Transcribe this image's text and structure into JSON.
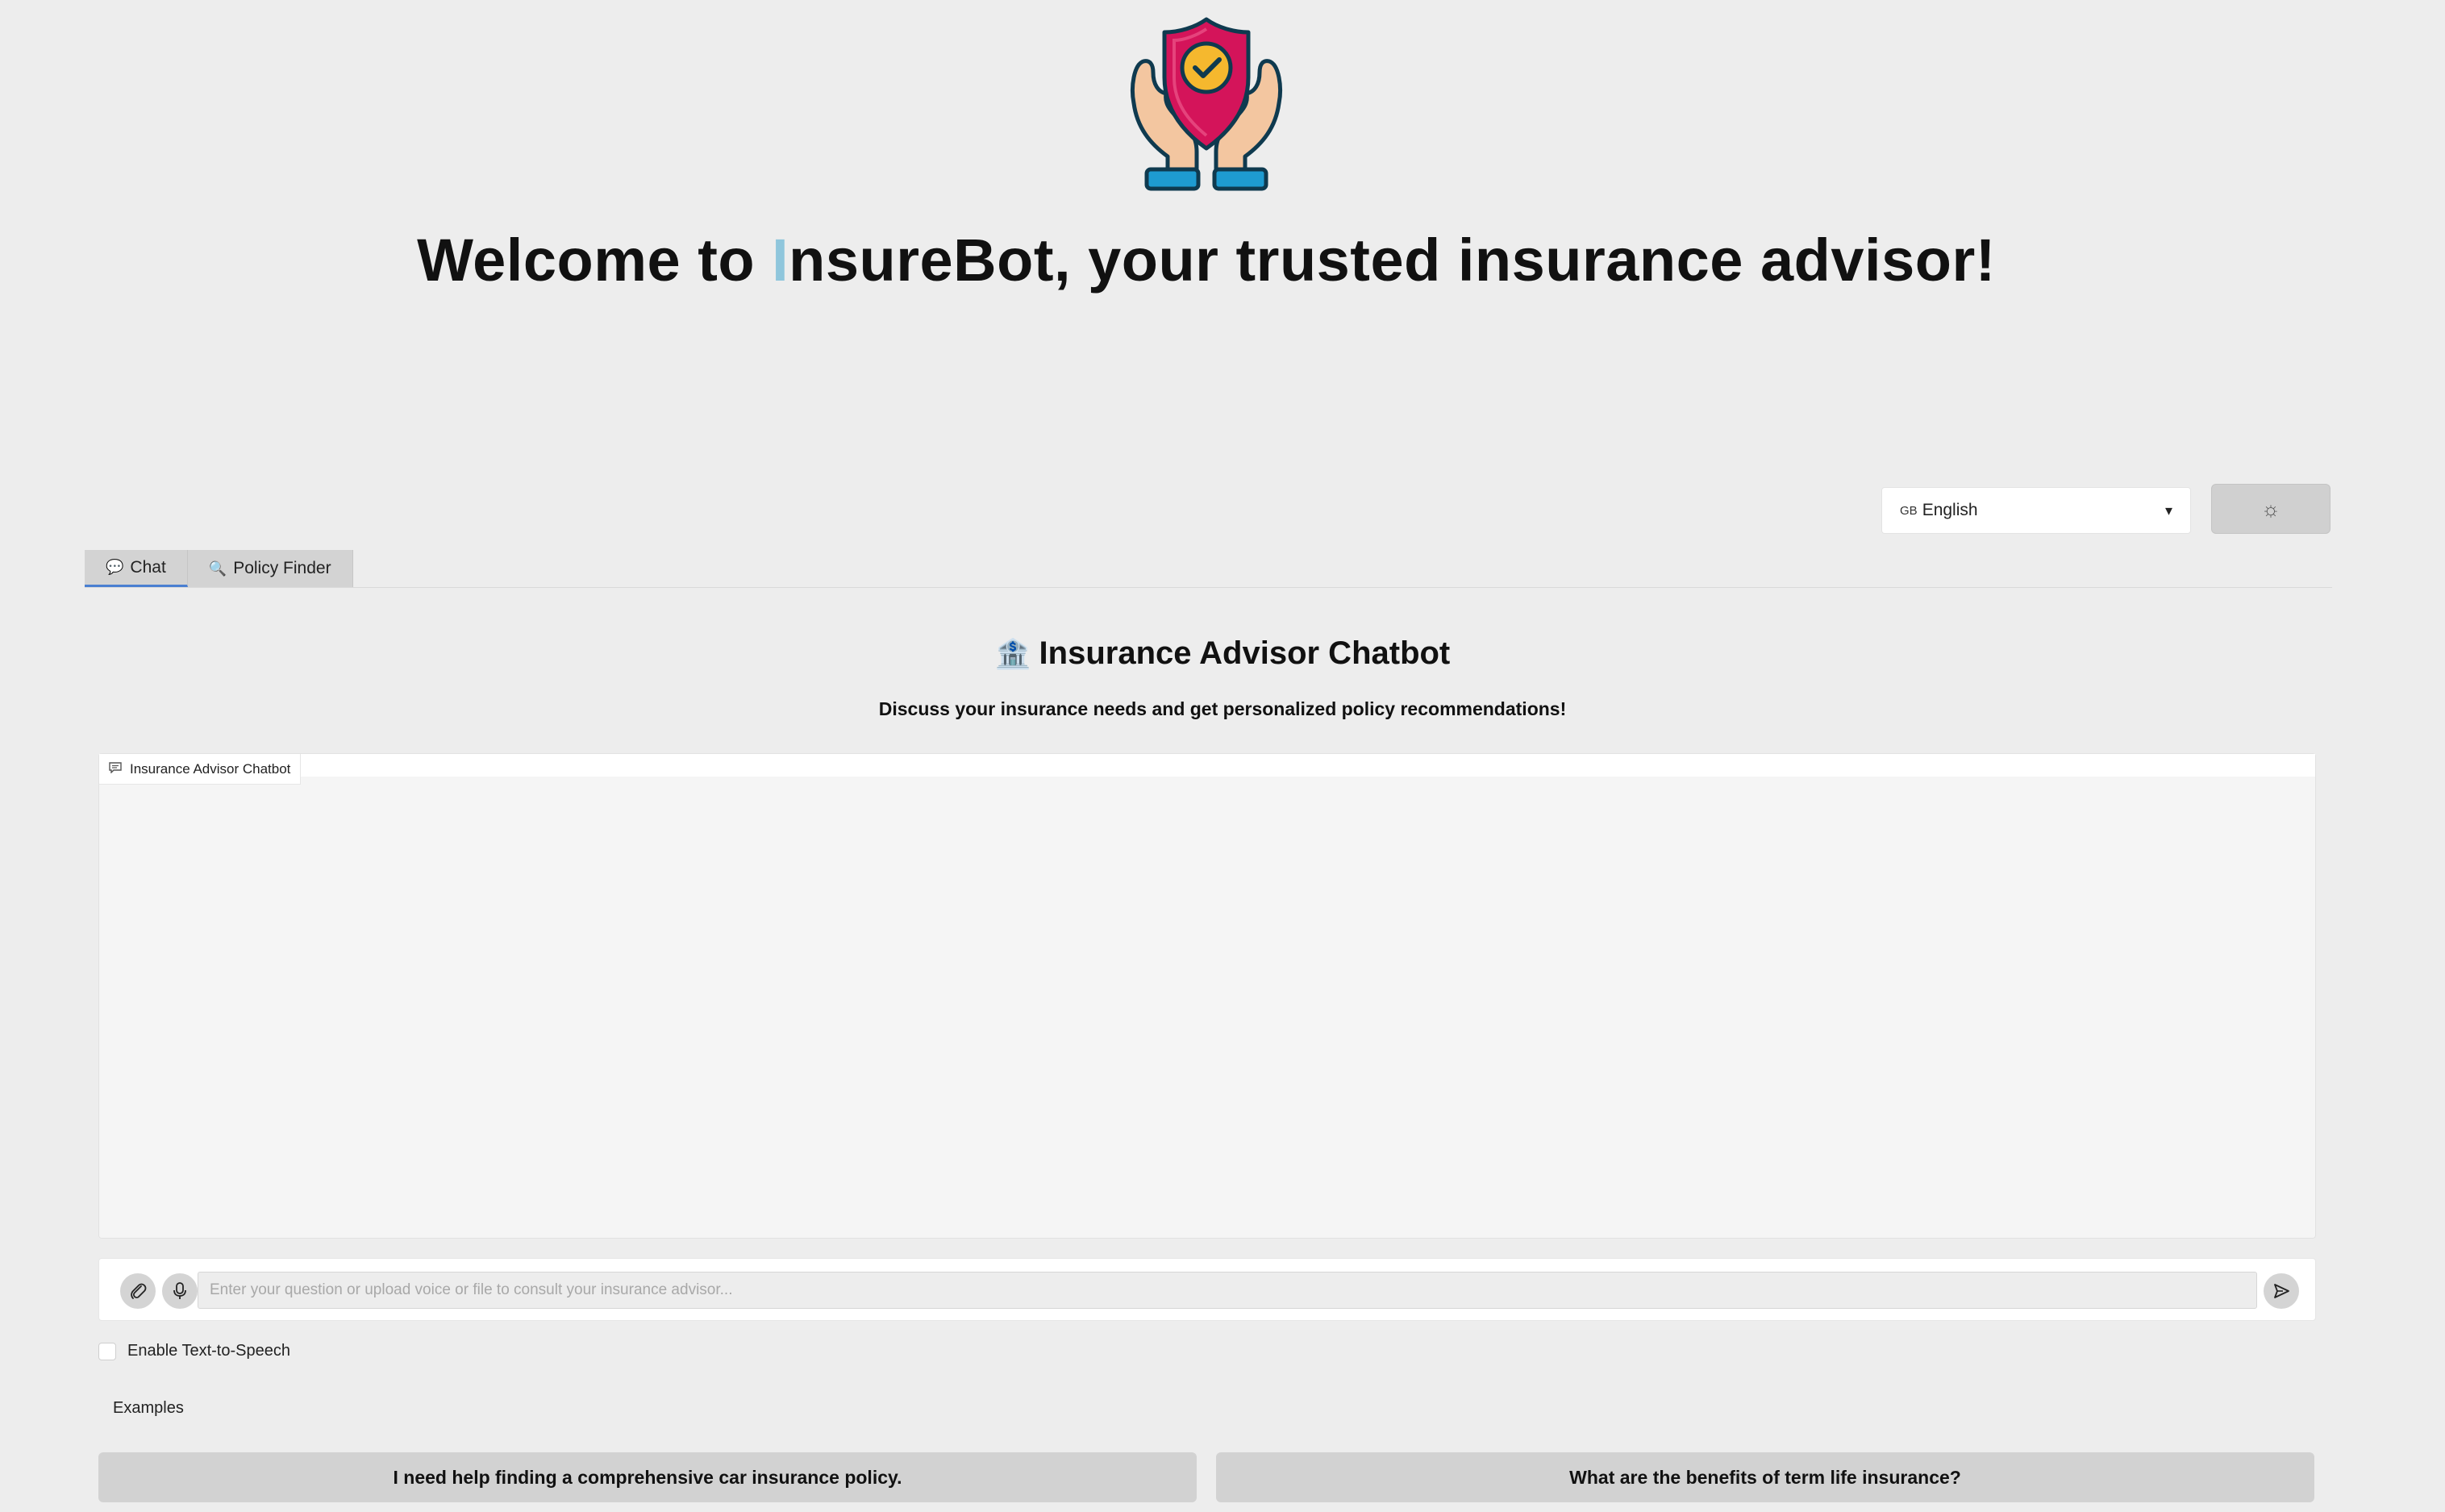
{
  "header": {
    "welcome_prefix": "Welcome to ",
    "welcome_i": "I",
    "welcome_suffix": "nsureBot, your trusted insurance advisor!"
  },
  "language": {
    "flag_code": "GB",
    "selected": "English"
  },
  "theme_toggle_icon": "sun-icon",
  "tabs": [
    {
      "icon": "💬",
      "label": "Chat",
      "active": true
    },
    {
      "icon": "🔍",
      "label": "Policy Finder",
      "active": false
    }
  ],
  "chat": {
    "title_icon": "🏦",
    "title": "Insurance Advisor Chatbot",
    "subtitle": "Discuss your insurance needs and get personalized policy recommendations!",
    "panel_label": "Insurance Advisor Chatbot"
  },
  "input": {
    "placeholder": "Enter your question or upload voice or file to consult your insurance advisor...",
    "value": ""
  },
  "tts_label": "Enable Text-to-Speech",
  "examples": {
    "label": "Examples",
    "items": [
      "I need help finding a comprehensive car insurance policy.",
      "What are the benefits of term life insurance?"
    ]
  },
  "colors": {
    "background": "#ededed",
    "shield": "#d4145a",
    "check_circle": "#f5b82e",
    "hands": "#f3c6a0",
    "cuffs": "#1e9bd1",
    "tab_underline": "#4a7fd1"
  }
}
